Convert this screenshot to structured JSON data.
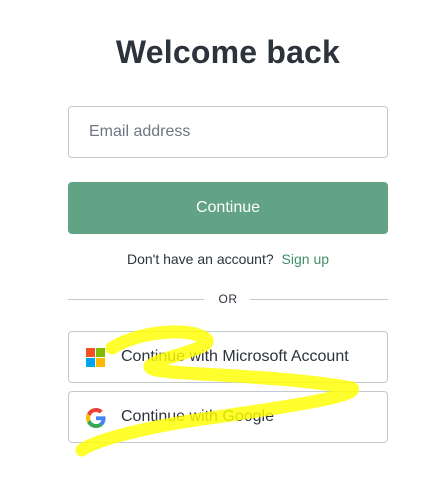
{
  "page": {
    "title": "Welcome back"
  },
  "form": {
    "email_placeholder": "Email address",
    "continue_label": "Continue"
  },
  "signup": {
    "prompt": "Don't have an account?",
    "link_label": "Sign up"
  },
  "divider": {
    "text": "OR"
  },
  "social": {
    "microsoft": {
      "label": "Continue with Microsoft Account",
      "icon": "microsoft-logo-icon",
      "colors": [
        "#f25022",
        "#7fba00",
        "#00a4ef",
        "#ffb900"
      ]
    },
    "google": {
      "label": "Continue with Google",
      "icon": "google-logo-icon"
    }
  },
  "colors": {
    "accent": "#62a285",
    "link": "#3f8f6a",
    "border": "#c2c8d0",
    "text": "#2d333a",
    "annotation_highlight": "#ffff00"
  }
}
